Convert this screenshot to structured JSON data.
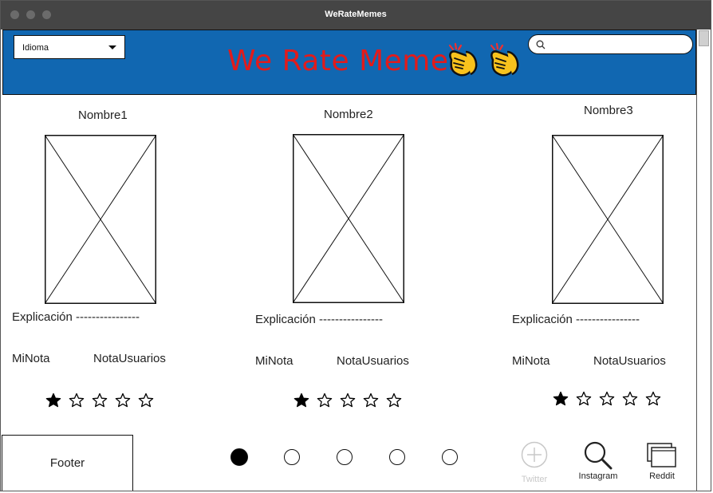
{
  "window": {
    "title": "WeRateMemes"
  },
  "header": {
    "language_dropdown": {
      "selected": "Idioma"
    },
    "brand_title": "We Rate Memes",
    "search": {
      "placeholder": "",
      "value": ""
    }
  },
  "memes": [
    {
      "name": "Nombre1",
      "explanation": "Explicación ----------------",
      "my_rating_label": "MiNota",
      "users_rating_label": "NotaUsuarios",
      "rating": 1,
      "max_rating": 5
    },
    {
      "name": "Nombre2",
      "explanation": "Explicación ----------------",
      "my_rating_label": "MiNota",
      "users_rating_label": "NotaUsuarios",
      "rating": 1,
      "max_rating": 5
    },
    {
      "name": "Nombre3",
      "explanation": "Explicación ----------------",
      "my_rating_label": "MiNota",
      "users_rating_label": "NotaUsuarios",
      "rating": 1,
      "max_rating": 5
    }
  ],
  "footer": {
    "label": "Footer"
  },
  "pagination": {
    "pages": 5,
    "current": 1
  },
  "social": [
    {
      "label": "Twitter",
      "icon": "add-circle-icon",
      "disabled": true
    },
    {
      "label": "Instagram",
      "icon": "search-icon",
      "disabled": false
    },
    {
      "label": "Reddit",
      "icon": "windows-icon",
      "disabled": false
    }
  ],
  "colors": {
    "header_bg": "#1167b1",
    "brand_text": "#e21b1b",
    "titlebar": "#454545",
    "disabled": "#c8c8c8"
  }
}
